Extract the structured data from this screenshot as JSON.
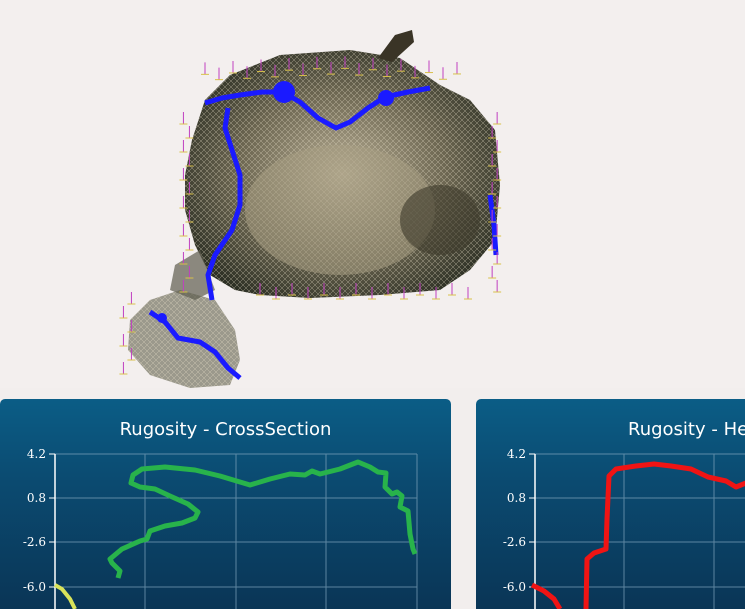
{
  "viewport": {
    "colors": {
      "background": "#f3efee",
      "contour": "#1a1aff"
    }
  },
  "charts": [
    {
      "title": "Rugosity - CrossSection",
      "yticks": [
        "4.2",
        "0.8",
        "-2.6",
        "-6.0"
      ],
      "colors": {
        "series": "#28b34b",
        "series2": "#d9e35a",
        "grid": "#7fa4bd"
      }
    },
    {
      "title": "Rugosity - He",
      "yticks": [
        "4.2",
        "0.8",
        "-2.6",
        "-6.0"
      ],
      "colors": {
        "series": "#f01414",
        "grid": "#7fa4bd"
      }
    }
  ]
}
